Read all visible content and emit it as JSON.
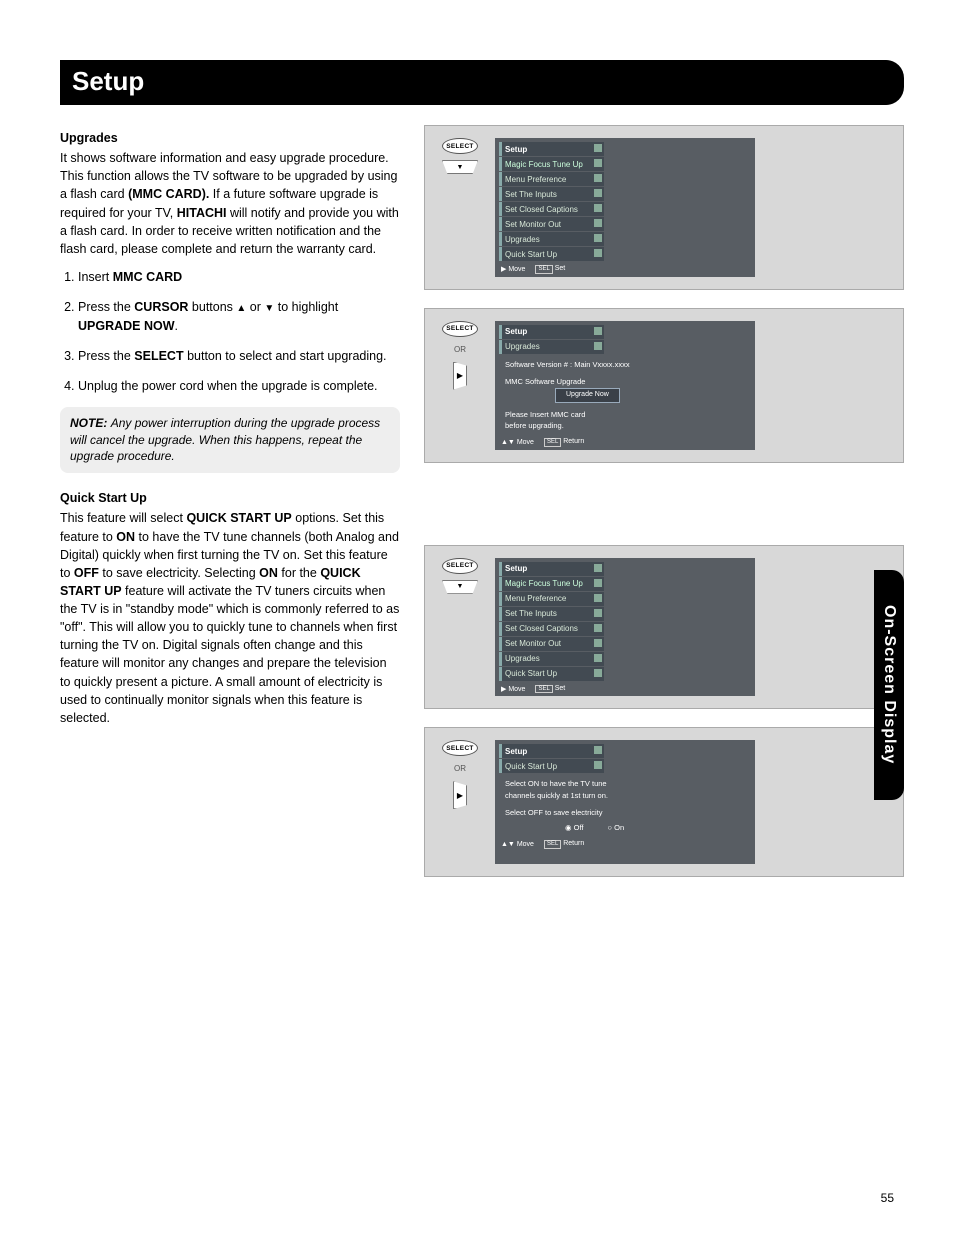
{
  "page": {
    "title": "Setup",
    "side_tab": "On-Screen Display",
    "page_number": "55"
  },
  "upgrades": {
    "heading": "Upgrades",
    "intro_1": "It shows software information and easy upgrade procedure. This function allows the TV software to be upgraded by using a flash card ",
    "mmc_card_bold": "(MMC CARD).",
    "intro_2": " If a future software upgrade is required for your TV, ",
    "hitachi_bold": "HITACHI",
    "intro_3": " will notify and provide you with a flash card. In order to receive written notification and the flash card, please complete and return the warranty card.",
    "step1_a": "Insert ",
    "step1_b": "MMC CARD",
    "step2_a": "Press the ",
    "step2_b": "CURSOR",
    "step2_c": " buttons ",
    "step2_d": " or ",
    "step2_e": " to highlight ",
    "step2_f": "UPGRADE NOW",
    "step3_a": "Press the ",
    "step3_b": "SELECT",
    "step3_c": " button to select and start upgrading.",
    "step4": "Unplug the power cord when the upgrade is complete.",
    "note_label": "NOTE:",
    "note_text": "Any power interruption during the upgrade process will cancel the upgrade. When this happens, repeat the upgrade procedure."
  },
  "quickstart": {
    "heading": "Quick Start Up",
    "p1_a": "This feature will select ",
    "p1_b": "QUICK START UP",
    "p1_c": " options. Set this feature to ",
    "p1_d": "ON",
    "p1_e": " to have the TV tune channels (both Analog and Digital) quickly when first turning the TV on. Set this feature to ",
    "p1_f": "OFF",
    "p1_g": " to save electricity. Selecting ",
    "p1_h": "ON",
    "p1_i": " for the ",
    "p1_j": "QUICK START UP",
    "p1_k": " feature will activate the TV tuners circuits when the TV is in \"standby mode\" which is commonly referred to as \"off\". This will allow you to quickly tune to channels when first turning the TV on. Digital signals often change and this feature will monitor any changes and prepare the television to quickly present a picture. A small amount of electricity is used to continually monitor signals when this feature is selected."
  },
  "remote": {
    "select": "SELECT",
    "or": "OR",
    "down": "▼",
    "right": "▶"
  },
  "osd": {
    "setup": "Setup",
    "items": {
      "magic_focus": "Magic Focus Tune Up",
      "menu_pref": "Menu Preference",
      "set_inputs": "Set The Inputs",
      "set_cc": "Set Closed Captions",
      "set_monitor": "Set Monitor Out",
      "upgrades": "Upgrades",
      "quick_start": "Quick Start Up"
    },
    "footer": {
      "move": "Move",
      "set": "Set",
      "return": "Return",
      "sel": "SEL"
    },
    "upgrade_screen": {
      "version": "Software Version #  :  Main Vxxxx.xxxx",
      "mmc_upgrade": "MMC Software Upgrade",
      "upgrade_now": "Upgrade Now",
      "insert1": "Please Insert MMC card",
      "insert2": "before upgrading."
    },
    "quick_screen": {
      "line1": "Select ON to have the TV tune",
      "line2": "channels quickly at 1st turn on.",
      "line3": "Select OFF to save electricity",
      "off": "Off",
      "on": "On"
    }
  }
}
